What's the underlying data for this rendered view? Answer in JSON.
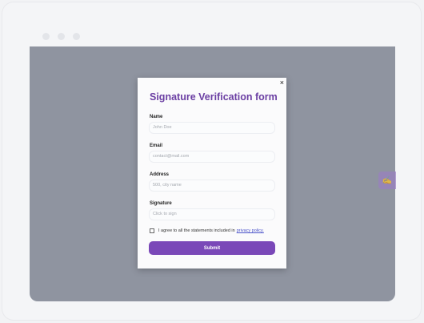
{
  "form": {
    "title": "Signature Verification form",
    "close_glyph": "×",
    "name": {
      "label": "Name",
      "placeholder": "John Doe"
    },
    "email": {
      "label": "Email",
      "placeholder": "contact@mail.com"
    },
    "address": {
      "label": "Address",
      "placeholder": "500, city name"
    },
    "signature": {
      "label": "Signature",
      "placeholder": "Click to sign"
    },
    "agree_text": "I agree to all the statements included in",
    "privacy_link": "privacy policy.",
    "submit_label": "Submit"
  },
  "side_tab": {
    "icon": "signature-icon",
    "glyph": "✍"
  },
  "colors": {
    "accent": "#7a48b8",
    "title": "#6b3fa3",
    "overlay": "#8f94a0",
    "link": "#4a52c9"
  }
}
